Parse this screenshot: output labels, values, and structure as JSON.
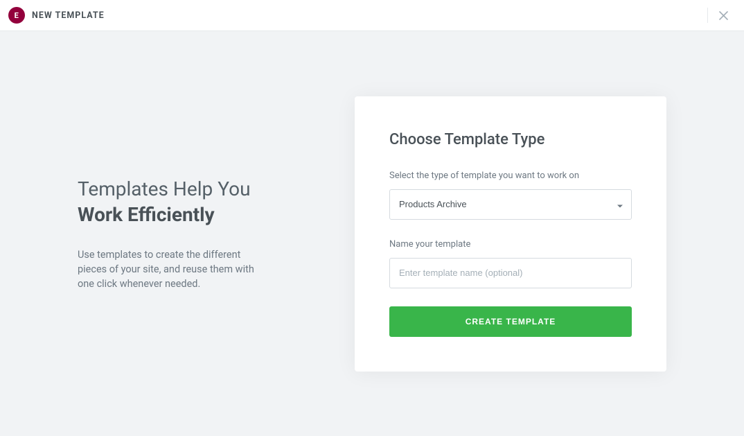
{
  "header": {
    "logo_text": "E",
    "title": "NEW TEMPLATE"
  },
  "intro": {
    "title_line1": "Templates Help You",
    "title_line2": "Work Efficiently",
    "description": "Use templates to create the different pieces of your site, and reuse them with one click whenever needed."
  },
  "form": {
    "heading": "Choose Template Type",
    "type_label": "Select the type of template you want to work on",
    "type_value": "Products Archive",
    "name_label": "Name your template",
    "name_placeholder": "Enter template name (optional)",
    "name_value": "",
    "submit_label": "CREATE TEMPLATE"
  },
  "colors": {
    "accent": "#39b54a",
    "brand": "#93003c"
  }
}
